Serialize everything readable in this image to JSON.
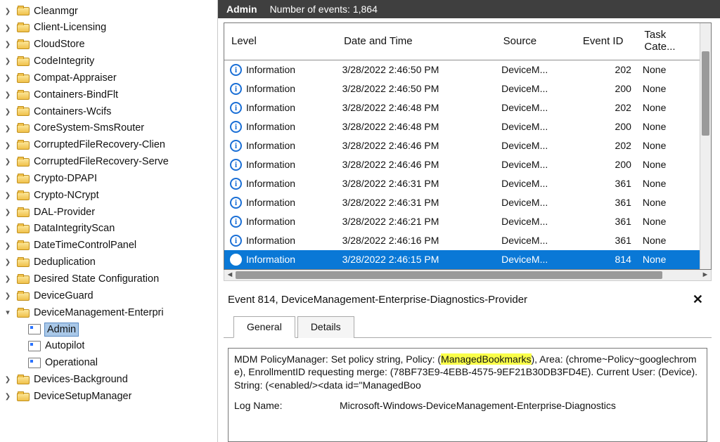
{
  "tree": {
    "items": [
      {
        "label": "Cleanmgr",
        "icon": "folder",
        "chev": "right"
      },
      {
        "label": "Client-Licensing",
        "icon": "folder",
        "chev": "right"
      },
      {
        "label": "CloudStore",
        "icon": "folder",
        "chev": "right"
      },
      {
        "label": "CodeIntegrity",
        "icon": "folder",
        "chev": "right"
      },
      {
        "label": "Compat-Appraiser",
        "icon": "folder",
        "chev": "right"
      },
      {
        "label": "Containers-BindFlt",
        "icon": "folder",
        "chev": "right"
      },
      {
        "label": "Containers-Wcifs",
        "icon": "folder",
        "chev": "right"
      },
      {
        "label": "CoreSystem-SmsRouter",
        "icon": "folder",
        "chev": "right"
      },
      {
        "label": "CorruptedFileRecovery-Clien",
        "icon": "folder",
        "chev": "right"
      },
      {
        "label": "CorruptedFileRecovery-Serve",
        "icon": "folder",
        "chev": "right"
      },
      {
        "label": "Crypto-DPAPI",
        "icon": "folder",
        "chev": "right"
      },
      {
        "label": "Crypto-NCrypt",
        "icon": "folder",
        "chev": "right"
      },
      {
        "label": "DAL-Provider",
        "icon": "folder",
        "chev": "right"
      },
      {
        "label": "DataIntegrityScan",
        "icon": "folder",
        "chev": "right"
      },
      {
        "label": "DateTimeControlPanel",
        "icon": "folder",
        "chev": "right"
      },
      {
        "label": "Deduplication",
        "icon": "folder",
        "chev": "right"
      },
      {
        "label": "Desired State Configuration",
        "icon": "folder",
        "chev": "right"
      },
      {
        "label": "DeviceGuard",
        "icon": "folder",
        "chev": "right"
      },
      {
        "label": "DeviceManagement-Enterpri",
        "icon": "folder",
        "chev": "down",
        "expanded": true,
        "children": [
          {
            "label": "Admin",
            "icon": "channel",
            "chev": "empty",
            "selected": true
          },
          {
            "label": "Autopilot",
            "icon": "channel",
            "chev": "empty"
          },
          {
            "label": "Operational",
            "icon": "channel",
            "chev": "empty"
          }
        ]
      },
      {
        "label": "Devices-Background",
        "icon": "folder",
        "chev": "right"
      },
      {
        "label": "DeviceSetupManager",
        "icon": "folder",
        "chev": "right"
      }
    ]
  },
  "header": {
    "title": "Admin",
    "summary_label": "Number of events:",
    "summary_value": "1,864"
  },
  "grid": {
    "columns": {
      "level": "Level",
      "date": "Date and Time",
      "source": "Source",
      "event_id": "Event ID",
      "task_cat": "Task Cate..."
    },
    "info_label": "Information",
    "rows": [
      {
        "date": "3/28/2022 2:46:50 PM",
        "source": "DeviceM...",
        "id": "202",
        "cat": "None"
      },
      {
        "date": "3/28/2022 2:46:50 PM",
        "source": "DeviceM...",
        "id": "200",
        "cat": "None"
      },
      {
        "date": "3/28/2022 2:46:48 PM",
        "source": "DeviceM...",
        "id": "202",
        "cat": "None"
      },
      {
        "date": "3/28/2022 2:46:48 PM",
        "source": "DeviceM...",
        "id": "200",
        "cat": "None"
      },
      {
        "date": "3/28/2022 2:46:46 PM",
        "source": "DeviceM...",
        "id": "202",
        "cat": "None"
      },
      {
        "date": "3/28/2022 2:46:46 PM",
        "source": "DeviceM...",
        "id": "200",
        "cat": "None"
      },
      {
        "date": "3/28/2022 2:46:31 PM",
        "source": "DeviceM...",
        "id": "361",
        "cat": "None"
      },
      {
        "date": "3/28/2022 2:46:31 PM",
        "source": "DeviceM...",
        "id": "361",
        "cat": "None"
      },
      {
        "date": "3/28/2022 2:46:21 PM",
        "source": "DeviceM...",
        "id": "361",
        "cat": "None"
      },
      {
        "date": "3/28/2022 2:46:16 PM",
        "source": "DeviceM...",
        "id": "361",
        "cat": "None"
      },
      {
        "date": "3/28/2022 2:46:15 PM",
        "source": "DeviceM...",
        "id": "814",
        "cat": "None",
        "selected": true
      }
    ]
  },
  "details": {
    "title": "Event 814, DeviceManagement-Enterprise-Diagnostics-Provider",
    "tabs": {
      "general": "General",
      "details": "Details"
    },
    "message_pre": "MDM PolicyManager: Set policy string, Policy: (",
    "message_hl": "ManagedBookmarks",
    "message_post": "), Area: (chrome~Policy~googlechrome), EnrollmentID requesting merge: (78BF73E9-4EBB-4575-9EF21B30DB3FD4E). Current User: (Device). String: (<enabled/><data id=\"ManagedBoo",
    "log_name_label": "Log Name:",
    "log_name_value": "Microsoft-Windows-DeviceManagement-Enterprise-Diagnostics"
  }
}
